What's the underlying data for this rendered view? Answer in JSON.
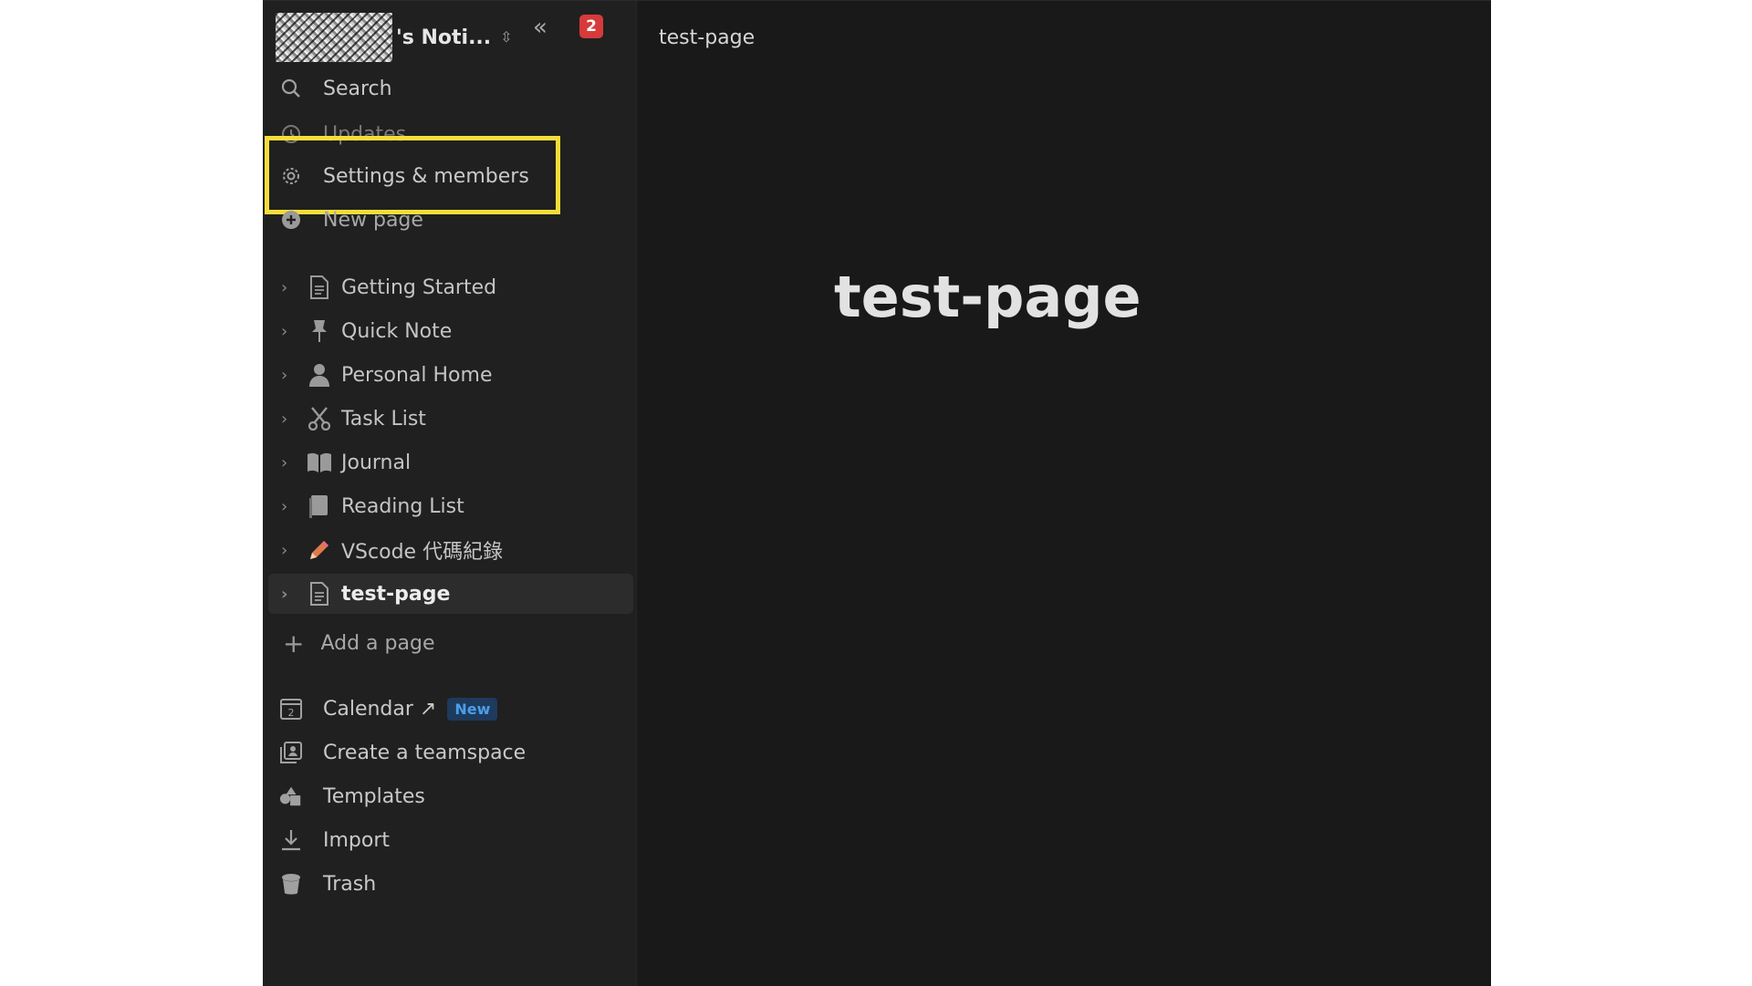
{
  "workspace": {
    "name": "'s Noti...",
    "notification_count": "2"
  },
  "nav": {
    "search": "Search",
    "updates": "Updates",
    "settings": "Settings & members",
    "new_page": "New page"
  },
  "pages": [
    {
      "label": "Getting Started",
      "icon": "document-icon"
    },
    {
      "label": "Quick Note",
      "icon": "pin-icon"
    },
    {
      "label": "Personal Home",
      "icon": "person-icon"
    },
    {
      "label": "Task List",
      "icon": "scissors-icon"
    },
    {
      "label": "Journal",
      "icon": "book-icon"
    },
    {
      "label": "Reading List",
      "icon": "notebook-icon"
    },
    {
      "label": "VScode 代碼紀錄",
      "icon": "pencil-icon"
    },
    {
      "label": "test-page",
      "icon": "document-icon",
      "active": true
    }
  ],
  "add_page": "Add a page",
  "bottom_nav": {
    "calendar": "Calendar ↗",
    "calendar_badge": "New",
    "teamspace": "Create a teamspace",
    "templates": "Templates",
    "import": "Import",
    "trash": "Trash"
  },
  "main": {
    "breadcrumb": "test-page",
    "title": "test-page"
  },
  "colors": {
    "highlight": "#f4dd3a",
    "badge_red": "#d73a3a",
    "new_badge_text": "#4c9eea"
  }
}
